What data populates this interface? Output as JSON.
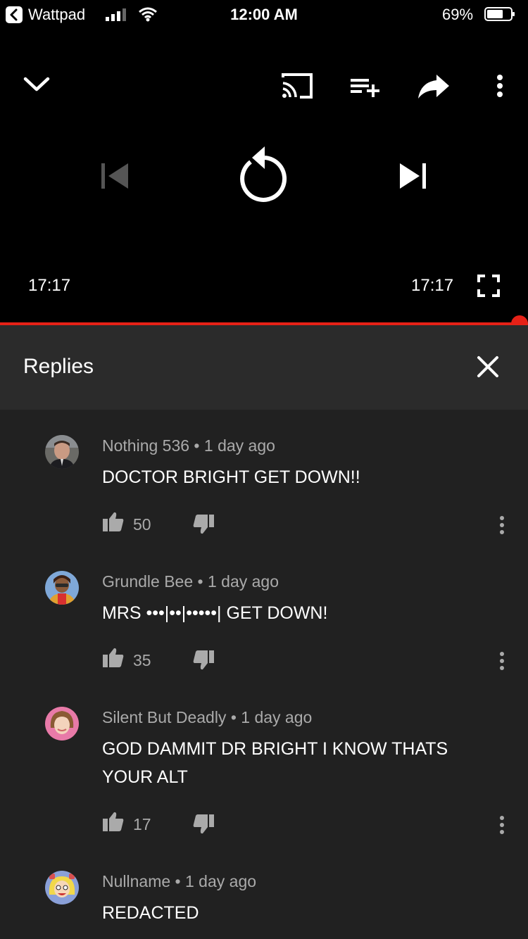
{
  "status_bar": {
    "back_app": "Wattpad",
    "time": "12:00 AM",
    "battery_percent": "69%",
    "battery_level": 0.69
  },
  "player": {
    "current_time": "17:17",
    "duration": "17:17",
    "progress": 1.0,
    "accent": "#e62117",
    "icons": [
      "chevron-down-icon",
      "cast-icon",
      "add-to-playlist-icon",
      "share-icon",
      "more-vertical-icon",
      "skip-previous-icon",
      "replay-icon",
      "skip-next-icon",
      "fullscreen-icon"
    ]
  },
  "replies": {
    "title": "Replies",
    "comments": [
      {
        "author": "Nothing 536",
        "age": "1 day ago",
        "text": "DOCTOR BRIGHT GET DOWN!!",
        "likes": "50"
      },
      {
        "author": "Grundle Bee",
        "age": "1 day ago",
        "text": "MRS •••|••|•••••| GET DOWN!",
        "likes": "35"
      },
      {
        "author": "Silent But Deadly",
        "age": "1 day ago",
        "text": "GOD DAMMIT DR BRIGHT I KNOW THATS YOUR ALT",
        "likes": "17"
      },
      {
        "author": "Nullname",
        "age": "1 day ago",
        "text": "REDACTED",
        "likes": ""
      }
    ]
  }
}
